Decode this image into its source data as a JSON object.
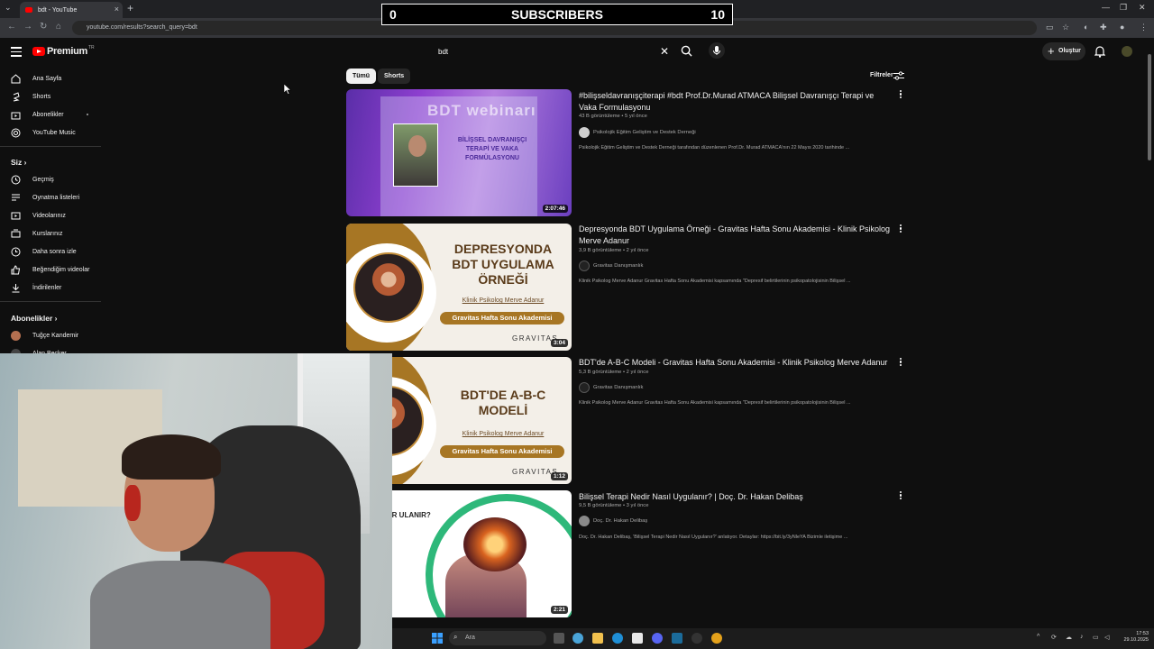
{
  "browser": {
    "tab_title": "bdt - YouTube",
    "url": "youtube.com/results?search_query=bdt"
  },
  "overlay": {
    "left_count": "0",
    "label": "SUBSCRIBERS",
    "right_count": "10"
  },
  "header": {
    "logo_text": "Premium",
    "logo_region": "TR",
    "search_value": "bdt",
    "create_label": "Oluştur"
  },
  "sidebar": {
    "main": [
      {
        "label": "Ana Sayfa",
        "icon": "home-icon"
      },
      {
        "label": "Shorts",
        "icon": "shorts-icon"
      },
      {
        "label": "Abonelikler",
        "icon": "subscriptions-icon"
      },
      {
        "label": "YouTube Music",
        "icon": "music-icon"
      }
    ],
    "you_heading": "Siz",
    "you_items": [
      {
        "label": "Geçmiş",
        "icon": "history-icon"
      },
      {
        "label": "Oynatma listeleri",
        "icon": "playlist-icon"
      },
      {
        "label": "Videolarınız",
        "icon": "your-videos-icon"
      },
      {
        "label": "Kurslarınız",
        "icon": "courses-icon"
      },
      {
        "label": "Daha sonra izle",
        "icon": "watch-later-icon"
      },
      {
        "label": "Beğendiğim videolar",
        "icon": "liked-icon"
      },
      {
        "label": "İndirilenler",
        "icon": "download-icon"
      }
    ],
    "subs_heading": "Abonelikler",
    "subs_items": [
      {
        "label": "Tuğçe Kandemir"
      },
      {
        "label": "Alan Becker"
      }
    ]
  },
  "chips": {
    "all": "Tümü",
    "shorts": "Shorts",
    "filters": "Filtreler"
  },
  "results": [
    {
      "title": "#bilişseldavranışçiterapi #bdt Prof.Dr.Murad ATMACA Bilişsel Davranışçı Terapi ve Vaka Formulasyonu",
      "meta": "43 B görüntüleme • 5 yıl önce",
      "channel": "Psikolojik Eğitim Geliştim ve Destek Derneği",
      "description": "Psikolojik Eğitim Geliştim ve Destek Derneği tarafından düzenlenen Prof.Dr. Murad ATMACA'nın 22 Mayıs 2020 tarihinde ...",
      "duration": "2:07:46",
      "thumb_title": "BİLİŞSEL DAVRANIŞÇI TERAPİ VE VAKA FORMÜLASYONU",
      "thumb_banner": "BDT webinarı"
    },
    {
      "title": "Depresyonda BDT Uygulama Örneği - Gravitas Hafta Sonu Akademisi - Klinik Psikolog Merve Adanur",
      "meta": "3,9 B görüntüleme • 2 yıl önce",
      "channel": "Gravitas Danışmanlık",
      "description": "Klinik Psikolog Merve Adanur Gravitas Hafta Sonu Akademisi kapsamında \"Depresif belirtilerinin psikopatolojisinin Bilişsel ...",
      "duration": "3:04",
      "thumb_title": "DEPRESYONDA BDT UYGULAMA ÖRNEĞİ",
      "thumb_sub": "Klinik Psikolog Merve Adanur",
      "thumb_pill": "Gravitas Hafta Sonu Akademisi",
      "thumb_brand": "GRAVITAS"
    },
    {
      "title": "BDT'de A-B-C Modeli - Gravitas Hafta Sonu Akademisi - Klinik Psikolog Merve Adanur",
      "meta": "5,3 B görüntüleme • 2 yıl önce",
      "channel": "Gravitas Danışmanlık",
      "description": "Klinik Psikolog Merve Adanur Gravitas Hafta Sonu Akademisi kapsamında \"Depresif belirtilerinin psikopatolojisinin Bilişsel ...",
      "duration": "1:12",
      "thumb_title": "BDT'DE A-B-C MODELİ",
      "thumb_sub": "Klinik Psikolog Merve Adanur",
      "thumb_pill": "Gravitas Hafta Sonu Akademisi",
      "thumb_brand": "GRAVITAS"
    },
    {
      "title": "Bilişsel Terapi Nedir Nasıl Uygulanır? | Doç. Dr. Hakan Delibaş",
      "meta": "9,5 B görüntüleme • 3 yıl önce",
      "channel": "Doç. Dr. Hakan Delibaş",
      "description": "Doç. Dr. Hakan Delibaş, 'Bilişsel Terapi Nedir Nasıl Uygulanır?' anlatıyor. Detaylar: https://bit.ly/3yNleYA Bizimle iletişime ...",
      "duration": "2:21",
      "thumb_text": "TERAPİ NEDİR ULANIR?"
    }
  ],
  "taskbar": {
    "search_placeholder": "Ara",
    "time": "17:53",
    "date": "29.10.2025"
  },
  "colors": {
    "background": "#0f0f0f",
    "youtube_red": "#ff0000",
    "accent_gold": "#a77624"
  }
}
